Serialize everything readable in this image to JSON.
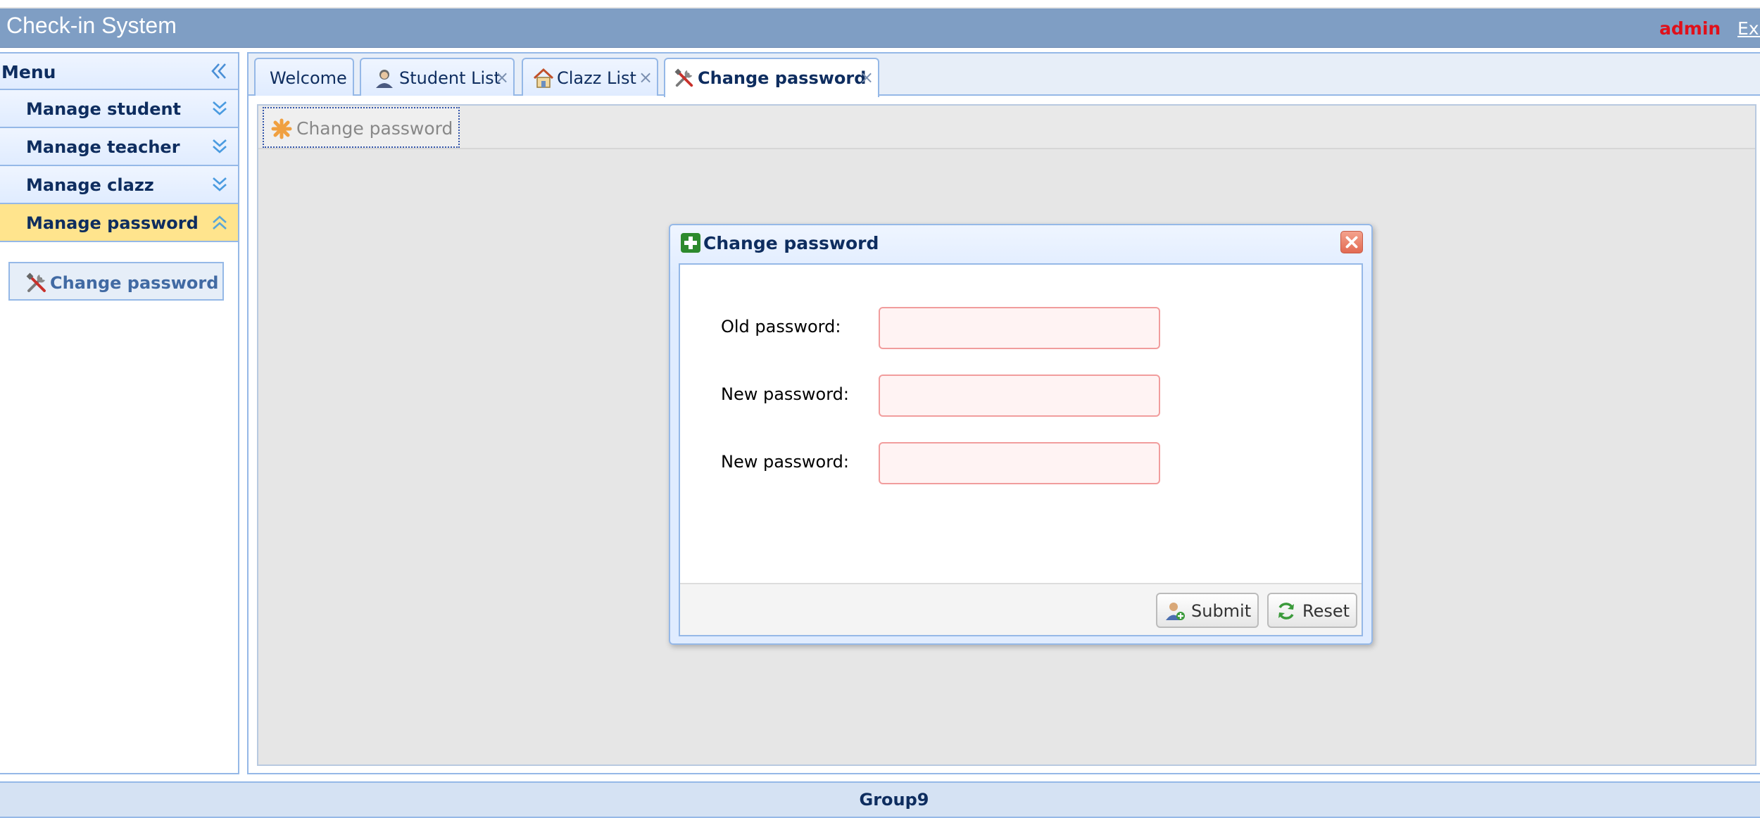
{
  "header": {
    "title": "Check-in System",
    "user": "admin",
    "exit_label": "Exi"
  },
  "sidebar": {
    "menu_label": "Menu",
    "items": [
      {
        "label": "Manage student",
        "expanded": false
      },
      {
        "label": "Manage teacher",
        "expanded": false
      },
      {
        "label": "Manage clazz",
        "expanded": false
      },
      {
        "label": "Manage password",
        "expanded": true
      }
    ],
    "sub_link": {
      "label": "Change password",
      "icon": "tools-icon"
    }
  },
  "tabs": [
    {
      "label": "Welcome",
      "closable": false
    },
    {
      "label": "Student List",
      "closable": true,
      "icon": "student-icon"
    },
    {
      "label": "Clazz List",
      "closable": true,
      "icon": "house-icon"
    },
    {
      "label": "Change password",
      "closable": true,
      "icon": "tools-icon",
      "active": true
    }
  ],
  "tab_close_glyph": "×",
  "inner_tab": {
    "label": "Change password"
  },
  "dialog": {
    "title": "Change password",
    "fields": [
      {
        "label": "Old password:",
        "value": ""
      },
      {
        "label": "New password:",
        "value": ""
      },
      {
        "label": "New password:",
        "value": ""
      }
    ],
    "buttons": {
      "submit": "Submit",
      "reset": "Reset"
    }
  },
  "footer": {
    "label": "Group9"
  },
  "colors": {
    "header_bg": "#7f9ec4",
    "accent_border": "#95b8e7",
    "active_menu": "#ffe48d",
    "user_name": "#e0101a"
  }
}
